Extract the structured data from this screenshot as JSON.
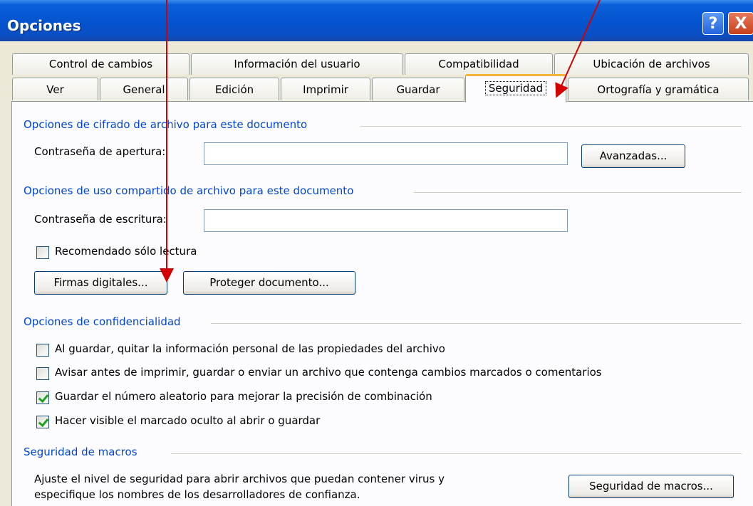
{
  "window": {
    "title": "Opciones",
    "help": "?",
    "close": "X"
  },
  "tabs_row1": [
    "Control de cambios",
    "Información del usuario",
    "Compatibilidad",
    "Ubicación de archivos"
  ],
  "tabs_row2": [
    "Ver",
    "General",
    "Edición",
    "Imprimir",
    "Guardar",
    "Seguridad",
    "Ortografía y gramática"
  ],
  "active_tab": "Seguridad",
  "encryption": {
    "title": "Opciones de cifrado de archivo para este documento",
    "open_password_label": "Contraseña de apertura:",
    "open_password_value": "",
    "advanced_button": "Avanzadas..."
  },
  "sharing": {
    "title": "Opciones de uso compartido de archivo para este documento",
    "write_password_label": "Contraseña de escritura:",
    "write_password_value": "",
    "readonly_label": "Recomendado sólo lectura",
    "readonly_checked": false,
    "digital_signatures_button": "Firmas digitales...",
    "protect_document_button": "Proteger documento..."
  },
  "privacy": {
    "title": "Opciones de confidencialidad",
    "options": [
      {
        "label": "Al guardar, quitar la información personal de las propiedades del archivo",
        "checked": false
      },
      {
        "label": "Avisar antes de imprimir, guardar o enviar un archivo que contenga cambios marcados o comentarios",
        "checked": false
      },
      {
        "label": "Guardar el número aleatorio para mejorar la precisión de combinación",
        "checked": true
      },
      {
        "label": "Hacer visible el marcado oculto al abrir o guardar",
        "checked": true
      }
    ]
  },
  "macros": {
    "title": "Seguridad de macros",
    "description_line1": "Ajuste el nivel de seguridad para abrir archivos que puedan contener virus y",
    "description_line2": "especifique los nombres de los desarrolladores de confianza.",
    "button": "Seguridad de macros..."
  },
  "colors": {
    "arrow": "#d40000",
    "section_title": "#0046d5",
    "active_tab_accent": "#f8b33a"
  }
}
